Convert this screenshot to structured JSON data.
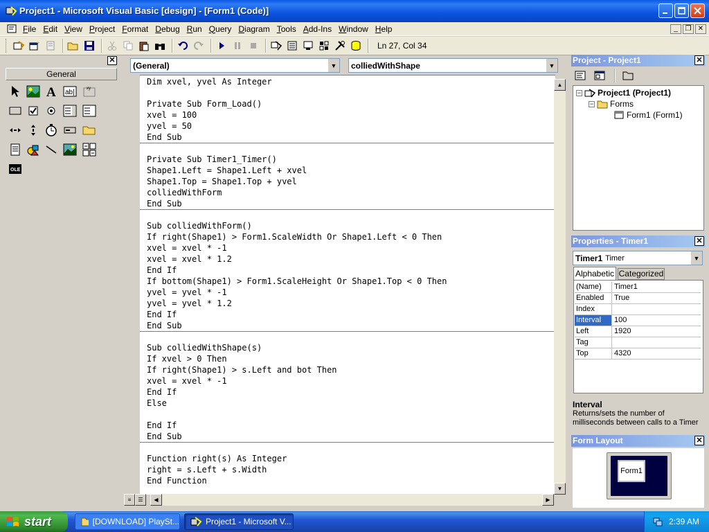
{
  "window": {
    "title": "Project1 - Microsoft Visual Basic [design] - [Form1 (Code)]"
  },
  "menubar": {
    "items": [
      "File",
      "Edit",
      "View",
      "Project",
      "Format",
      "Debug",
      "Run",
      "Query",
      "Diagram",
      "Tools",
      "Add-Ins",
      "Window",
      "Help"
    ]
  },
  "toolbar": {
    "position": "Ln 27, Col 34"
  },
  "toolbox": {
    "tab_label": "General"
  },
  "code_window": {
    "object_combo": "(General)",
    "procedure_combo": "colliedWithShape",
    "lines": [
      "Dim xvel, yvel As Integer",
      "",
      "Private Sub Form_Load()",
      "xvel = 100",
      "yvel = 50",
      "End Sub",
      "",
      "Private Sub Timer1_Timer()",
      "Shape1.Left = Shape1.Left + xvel",
      "Shape1.Top = Shape1.Top + yvel",
      "colliedWithForm",
      "End Sub",
      "",
      "Sub colliedWithForm()",
      "If right(Shape1) > Form1.ScaleWidth Or Shape1.Left < 0 Then",
      "xvel = xvel * -1",
      "xvel = xvel * 1.2",
      "End If",
      "If bottom(Shape1) > Form1.ScaleHeight Or Shape1.Top < 0 Then",
      "yvel = yvel * -1",
      "yvel = yvel * 1.2",
      "End If",
      "End Sub",
      "",
      "Sub colliedWithShape(s)",
      "If xvel > 0 Then",
      "If right(Shape1) > s.Left and bot Then",
      "xvel = xvel * -1",
      "End If",
      "Else",
      "",
      "End If",
      "End Sub",
      "",
      "Function right(s) As Integer",
      "right = s.Left + s.Width",
      "End Function"
    ]
  },
  "project_pane": {
    "title": "Project - Project1",
    "root": "Project1 (Project1)",
    "folder": "Forms",
    "form": "Form1 (Form1)"
  },
  "properties_pane": {
    "title": "Properties - Timer1",
    "object_name": "Timer1",
    "object_type": "Timer",
    "tab_alphabetic": "Alphabetic",
    "tab_categorized": "Categorized",
    "rows": [
      {
        "key": "(Name)",
        "value": "Timer1"
      },
      {
        "key": "Enabled",
        "value": "True"
      },
      {
        "key": "Index",
        "value": ""
      },
      {
        "key": "Interval",
        "value": "100"
      },
      {
        "key": "Left",
        "value": "1920"
      },
      {
        "key": "Tag",
        "value": ""
      },
      {
        "key": "Top",
        "value": "4320"
      }
    ],
    "desc_title": "Interval",
    "desc_text": "Returns/sets the number of milliseconds between calls to a Timer"
  },
  "form_layout": {
    "title": "Form Layout",
    "form_label": "Form1"
  },
  "taskbar": {
    "start_label": "start",
    "tasks": [
      {
        "label": "[DOWNLOAD] PlaySt..."
      },
      {
        "label": "Project1 - Microsoft V..."
      }
    ],
    "clock": "2:39 AM"
  },
  "colors": {
    "xp_title_blue": "#0b55de",
    "pane_active": "#0a246a",
    "selection": "#316ac5",
    "start_green": "#3c9a3c"
  }
}
